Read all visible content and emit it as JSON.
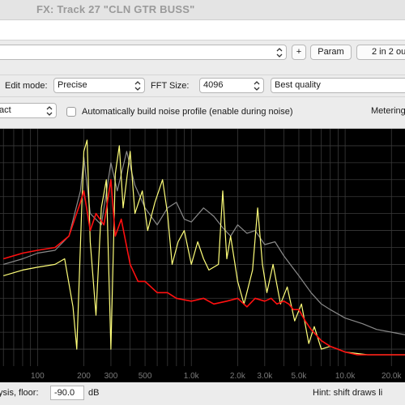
{
  "window": {
    "title": "FX: Track 27 \"CLN GTR BUSS\""
  },
  "toolbar": {
    "plus_label": "+",
    "param_label": "Param",
    "io_label": "2 in 2 ou"
  },
  "controls": {
    "edit_mode_label": "Edit mode:",
    "edit_mode_value": "Precise",
    "fft_size_label": "FFT Size:",
    "fft_size_value": "4096",
    "quality_value": "Best quality",
    "mode_value_partial": "act",
    "auto_noise_label": "Automatically build noise profile (enable during noise)",
    "auto_noise_checked": false,
    "metering_label": "Metering"
  },
  "chart_data": {
    "type": "line",
    "x_scale": "log",
    "x_tick_labels": [
      "100",
      "200",
      "300",
      "500",
      "1.0k",
      "2.0k",
      "3.0k",
      "5.0k",
      "10.0k",
      "20.0k"
    ],
    "x_tick_values": [
      100,
      200,
      300,
      500,
      1000,
      2000,
      3000,
      5000,
      10000,
      20000
    ],
    "grid": true,
    "background": "#000000",
    "series": [
      {
        "color": "#8a8a8a",
        "points": [
          [
            60,
            -60
          ],
          [
            80,
            -58
          ],
          [
            100,
            -56
          ],
          [
            130,
            -55
          ],
          [
            160,
            -50
          ],
          [
            190,
            -34
          ],
          [
            200,
            -22
          ],
          [
            220,
            -42
          ],
          [
            260,
            -46
          ],
          [
            300,
            -24
          ],
          [
            330,
            -34
          ],
          [
            380,
            -20
          ],
          [
            430,
            -32
          ],
          [
            500,
            -40
          ],
          [
            600,
            -46
          ],
          [
            700,
            -40
          ],
          [
            800,
            -38
          ],
          [
            900,
            -44
          ],
          [
            1000,
            -45
          ],
          [
            1200,
            -40
          ],
          [
            1400,
            -43
          ],
          [
            1600,
            -47
          ],
          [
            1800,
            -50
          ],
          [
            2000,
            -46
          ],
          [
            2300,
            -49
          ],
          [
            2600,
            -48
          ],
          [
            3000,
            -53
          ],
          [
            3500,
            -52
          ],
          [
            4000,
            -57
          ],
          [
            5000,
            -64
          ],
          [
            6000,
            -70
          ],
          [
            7000,
            -74
          ],
          [
            8000,
            -76
          ],
          [
            10000,
            -79
          ],
          [
            13000,
            -81
          ],
          [
            16000,
            -83
          ],
          [
            20000,
            -84
          ],
          [
            25000,
            -85
          ]
        ]
      },
      {
        "color": "#ffff7a",
        "points": [
          [
            60,
            -64
          ],
          [
            80,
            -62
          ],
          [
            100,
            -61
          ],
          [
            130,
            -60
          ],
          [
            150,
            -58
          ],
          [
            170,
            -75
          ],
          [
            180,
            -90
          ],
          [
            195,
            -36
          ],
          [
            200,
            -20
          ],
          [
            210,
            -16
          ],
          [
            220,
            -52
          ],
          [
            240,
            -78
          ],
          [
            260,
            -40
          ],
          [
            280,
            -30
          ],
          [
            300,
            -90
          ],
          [
            320,
            -28
          ],
          [
            340,
            -18
          ],
          [
            360,
            -40
          ],
          [
            400,
            -20
          ],
          [
            430,
            -42
          ],
          [
            480,
            -34
          ],
          [
            520,
            -48
          ],
          [
            580,
            -38
          ],
          [
            650,
            -30
          ],
          [
            700,
            -42
          ],
          [
            750,
            -60
          ],
          [
            820,
            -52
          ],
          [
            900,
            -48
          ],
          [
            1000,
            -60
          ],
          [
            1100,
            -52
          ],
          [
            1200,
            -58
          ],
          [
            1300,
            -62
          ],
          [
            1500,
            -60
          ],
          [
            1600,
            -34
          ],
          [
            1700,
            -58
          ],
          [
            1800,
            -50
          ],
          [
            2000,
            -66
          ],
          [
            2200,
            -74
          ],
          [
            2500,
            -62
          ],
          [
            2700,
            -40
          ],
          [
            2900,
            -60
          ],
          [
            3100,
            -70
          ],
          [
            3400,
            -60
          ],
          [
            3800,
            -74
          ],
          [
            4200,
            -68
          ],
          [
            4700,
            -80
          ],
          [
            5200,
            -74
          ],
          [
            5800,
            -88
          ],
          [
            6300,
            -82
          ],
          [
            7000,
            -90
          ],
          [
            8000,
            -89
          ],
          [
            10000,
            -91
          ],
          [
            14000,
            -92
          ],
          [
            20000,
            -92
          ],
          [
            25000,
            -92
          ]
        ]
      },
      {
        "color": "#ff1010",
        "points": [
          [
            60,
            -58
          ],
          [
            80,
            -56
          ],
          [
            100,
            -55
          ],
          [
            130,
            -54
          ],
          [
            160,
            -50
          ],
          [
            190,
            -38
          ],
          [
            200,
            -34
          ],
          [
            220,
            -48
          ],
          [
            240,
            -42
          ],
          [
            270,
            -46
          ],
          [
            300,
            -30
          ],
          [
            320,
            -50
          ],
          [
            350,
            -44
          ],
          [
            400,
            -60
          ],
          [
            450,
            -66
          ],
          [
            500,
            -66
          ],
          [
            600,
            -70
          ],
          [
            700,
            -70
          ],
          [
            800,
            -72
          ],
          [
            1000,
            -73
          ],
          [
            1200,
            -72
          ],
          [
            1400,
            -74
          ],
          [
            1700,
            -73
          ],
          [
            2000,
            -72
          ],
          [
            2300,
            -75
          ],
          [
            2600,
            -72
          ],
          [
            3000,
            -73
          ],
          [
            3300,
            -72
          ],
          [
            3600,
            -74
          ],
          [
            4000,
            -73
          ],
          [
            4300,
            -74
          ],
          [
            4600,
            -76
          ],
          [
            5000,
            -76
          ],
          [
            5500,
            -80
          ],
          [
            6000,
            -83
          ],
          [
            7000,
            -87
          ],
          [
            8000,
            -89
          ],
          [
            9000,
            -90
          ],
          [
            10000,
            -91
          ],
          [
            12000,
            -92
          ],
          [
            15000,
            -92
          ],
          [
            20000,
            -92
          ],
          [
            25000,
            -92
          ]
        ]
      }
    ]
  },
  "bottom": {
    "floor_label_partial": "ysis, floor:",
    "floor_value": "-90.0",
    "floor_unit": "dB",
    "hint_text_partial": "Hint: shift draws li"
  },
  "colors": {
    "window_bg": "#e9e9e9",
    "plot_bg": "#000000",
    "grid": "#3a3a3a",
    "axis_text": "#7a7a7a"
  }
}
